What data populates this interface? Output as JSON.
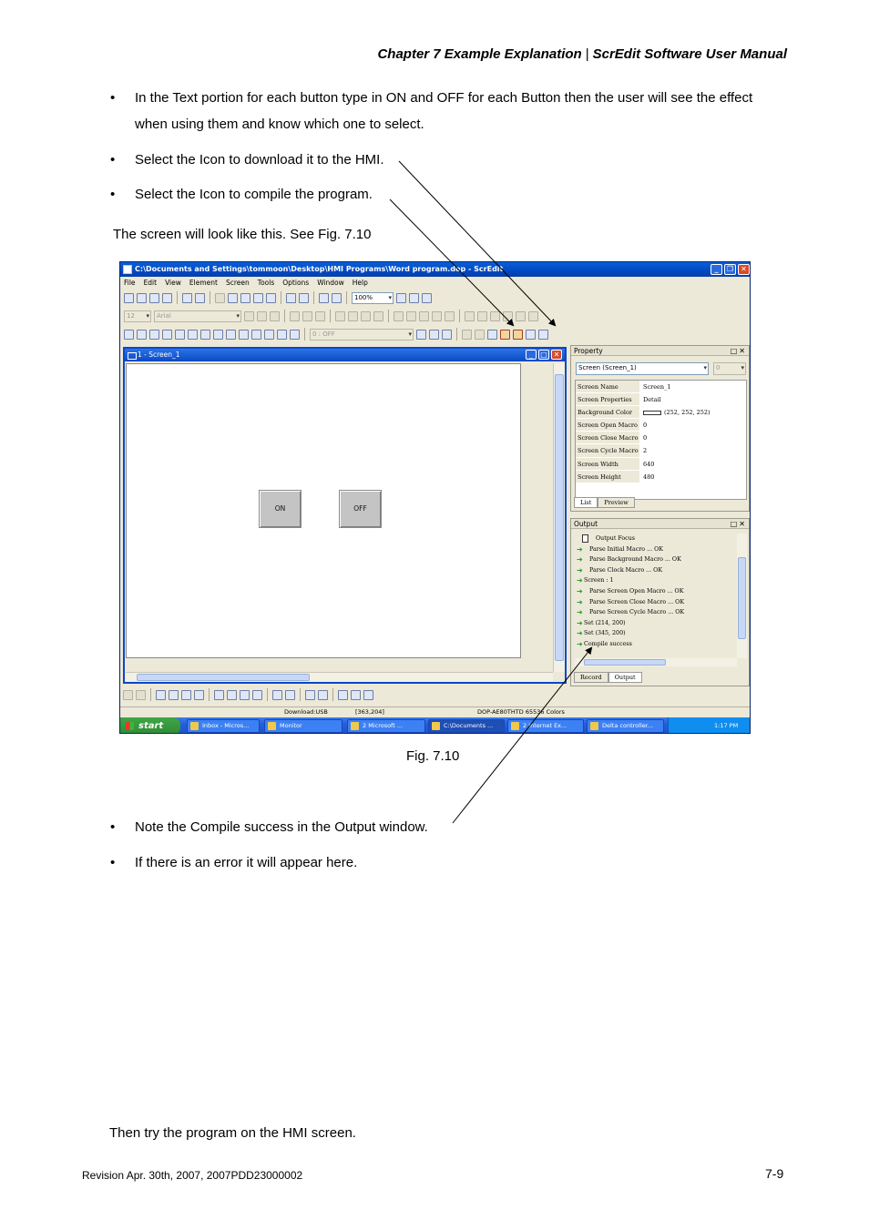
{
  "header": {
    "chapter": "Chapter 7  Example Explanation",
    "separator": "|",
    "manual": "ScrEdit Software User Manual"
  },
  "bullets_top": [
    "In the Text portion for each button type in ON and OFF for each Button then the user will see the effect when using them and know which one to select.",
    "Select the Icon to download it to the HMI.",
    "Select the Icon to compile the program."
  ],
  "intro": "The screen will look like this. See Fig. 7.10",
  "screenshot": {
    "title": "C:\\Documents and Settings\\tommoon\\Desktop\\HMI Programs\\Word program.dop - ScrEdit",
    "menu": [
      "File",
      "Edit",
      "View",
      "Element",
      "Screen",
      "Tools",
      "Options",
      "Window",
      "Help"
    ],
    "zoom": "100%",
    "font_size": "12",
    "font_name": "Arial",
    "state_select": "0 : OFF",
    "doc_title": "1 - Screen_1",
    "btn_on": "ON",
    "btn_off": "OFF",
    "property": {
      "title": "Property",
      "controls": "□✕",
      "selector": "Screen (Screen_1)",
      "selector2": "0",
      "rows": [
        {
          "k": "Screen Name",
          "v": "Screen_1"
        },
        {
          "k": "Screen Properties",
          "v": "Detail"
        },
        {
          "k": "Background Color",
          "v": "(252, 252, 252)"
        },
        {
          "k": "Screen Open Macro",
          "v": "0"
        },
        {
          "k": "Screen Close Macro",
          "v": "0"
        },
        {
          "k": "Screen Cycle Macro",
          "v": "2"
        },
        {
          "k": "Screen Width",
          "v": "640"
        },
        {
          "k": "Screen Height",
          "v": "480"
        }
      ],
      "tab_list": "List",
      "tab_preview": "Preview"
    },
    "output": {
      "title": "Output",
      "controls": "□✕",
      "head": "Output Focus",
      "lines": [
        {
          "t": "Parse Initial Macro ... OK",
          "lvl": 2
        },
        {
          "t": "Parse Background Macro ... OK",
          "lvl": 2
        },
        {
          "t": "Parse Clock Macro ... OK",
          "lvl": 2
        },
        {
          "t": "Screen : 1",
          "lvl": 1
        },
        {
          "t": "Parse Screen Open Macro ... OK",
          "lvl": 2
        },
        {
          "t": "Parse Screen Close Macro ... OK",
          "lvl": 2
        },
        {
          "t": "Parse Screen Cycle Macro ... OK",
          "lvl": 2
        },
        {
          "t": "Set (214, 200)",
          "lvl": 1
        },
        {
          "t": "Set (345, 200)",
          "lvl": 1
        },
        {
          "t": "Compile success",
          "lvl": 1
        }
      ],
      "tab_record": "Record",
      "tab_output": "Output"
    },
    "status": {
      "download": "Download:USB",
      "coords": "[363,204]",
      "model": "DOP-AE80THTD 65536 Colors"
    },
    "taskbar": {
      "start": "start",
      "tasks": [
        "Inbox - Micros...",
        "Monitor",
        "2 Microsoft ...",
        "C:\\Documents ...",
        "2 Internet Ex...",
        "Delta controller..."
      ],
      "clock": "1:17 PM"
    }
  },
  "caption": "Fig. 7.10",
  "bullets_bottom": [
    "Note the Compile success in the Output window.",
    "If there is an error it will appear here."
  ],
  "closing": "Then try the program on the HMI screen.",
  "footer": {
    "revision": "Revision Apr. 30th, 2007, 2007PDD23000002",
    "page": "7-9"
  }
}
